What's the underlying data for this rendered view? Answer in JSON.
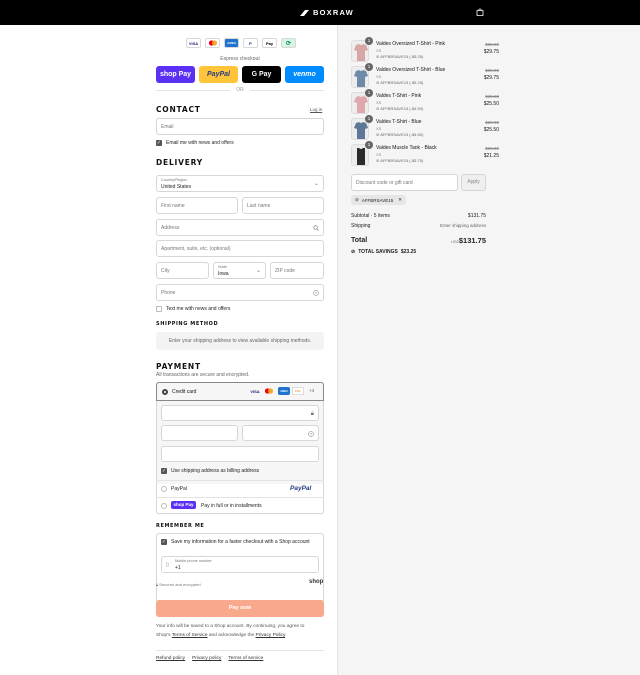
{
  "brand": {
    "name": "BOXRAW"
  },
  "payment_icons": [
    "VISA",
    "MC",
    "AMEX",
    "P",
    "Pay",
    "⟳"
  ],
  "express": {
    "label": "Express checkout",
    "shop_pay": "shop Pay",
    "paypal": "PayPal",
    "gpay": "G Pay",
    "venmo": "venmo",
    "or": "OR"
  },
  "contact": {
    "heading": "CONTACT",
    "login": "Log in",
    "email_placeholder": "Email",
    "news_label": "Email me with news and offers"
  },
  "delivery": {
    "heading": "DELIVERY",
    "country_label": "Country/Region",
    "country_value": "United States",
    "first_name": "First name",
    "last_name": "Last name",
    "address": "Address",
    "apartment": "Apartment, suite, etc. (optional)",
    "city": "City",
    "state_label": "State",
    "state_value": "Iowa",
    "zip": "ZIP code",
    "phone": "Phone",
    "text_label": "Text me with news and offers"
  },
  "shipping_method": {
    "heading": "SHIPPING METHOD",
    "note": "Enter your shipping address to view available shipping methods."
  },
  "payment": {
    "heading": "PAYMENT",
    "subtitle": "All transactions are secure and encrypted.",
    "credit_card": "Credit card",
    "more_cards": "+4",
    "billing_label": "Use shipping address as billing address",
    "paypal_label": "PayPal",
    "paypal_logo": "PayPal",
    "shoppay_label": "Pay in full or in installments",
    "shoppay_logo": "shop Pay"
  },
  "remember": {
    "heading": "REMEMBER ME",
    "save_label": "Save my information for a faster checkout with a Shop account",
    "mobile_label": "Mobile phone number",
    "mobile_value": "+1",
    "secure": "Secured and encrypted",
    "shop_logo": "shop"
  },
  "pay_now": "Pay now",
  "legal": {
    "line1": "Your info will be saved to a Shop account. By continuing, you agree to",
    "line2_pre": "Shop's",
    "terms": "Terms of Service",
    "line2_mid": "and acknowledge the",
    "privacy": "Privacy Policy",
    "line2_end": "."
  },
  "footer": [
    "Refund policy",
    "Privacy policy",
    "Terms of service"
  ],
  "cart": {
    "items": [
      {
        "name": "Valdes Oversized T-Shirt - Pink",
        "variant": "XS",
        "discount": "AFFBRSAVE15 (-$5.25)",
        "old": "$35.00",
        "new": "$29.75",
        "qty": "1",
        "color": "#d9a6a8"
      },
      {
        "name": "Valdes Oversized T-Shirt - Blue",
        "variant": "XS",
        "discount": "AFFBRSAVE15 (-$5.25)",
        "old": "$35.00",
        "new": "$29.75",
        "qty": "1",
        "color": "#6e8aa8"
      },
      {
        "name": "Valdes T-Shirt - Pink",
        "variant": "XS",
        "discount": "AFFBRSAVE15 (-$4.50)",
        "old": "$30.00",
        "new": "$25.50",
        "qty": "1",
        "color": "#e0a8ac"
      },
      {
        "name": "Valdes T-Shirt - Blue",
        "variant": "XS",
        "discount": "AFFBRSAVE15 (-$4.50)",
        "old": "$30.00",
        "new": "$25.50",
        "qty": "1",
        "color": "#5d7896"
      },
      {
        "name": "Valdes Muscle Tank - Black",
        "variant": "XS",
        "discount": "AFFBRSAVE15 (-$3.75)",
        "old": "$25.00",
        "new": "$21.25",
        "qty": "1",
        "color": "#2a2a2a"
      }
    ],
    "discount_placeholder": "Discount code or gift card",
    "apply": "Apply",
    "applied_code": "AFFBRSAVE15",
    "subtotal_label": "Subtotal · 5 items",
    "subtotal": "$131.75",
    "shipping_label": "Shipping",
    "shipping_value": "Enter shipping address",
    "total_label": "Total",
    "currency": "USD",
    "total": "$131.75",
    "savings_label": "TOTAL SAVINGS",
    "savings": "$23.25"
  }
}
